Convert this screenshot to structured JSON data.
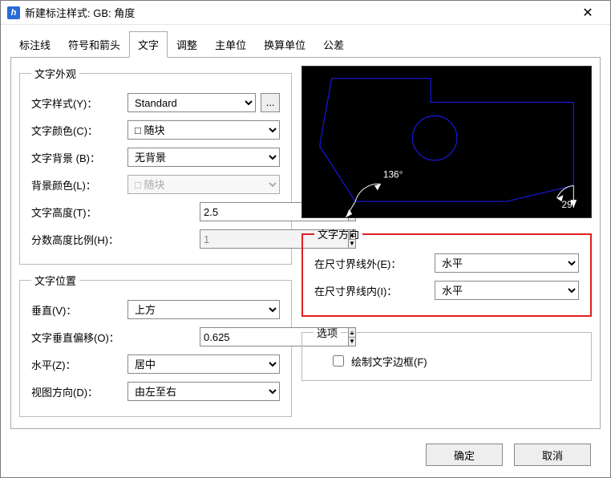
{
  "window": {
    "title": "新建标注样式: GB: 角度"
  },
  "tabs": {
    "items": [
      {
        "label": "标注线"
      },
      {
        "label": "符号和箭头"
      },
      {
        "label": "文字"
      },
      {
        "label": "调整"
      },
      {
        "label": "主单位"
      },
      {
        "label": "换算单位"
      },
      {
        "label": "公差"
      }
    ],
    "active_index": 2
  },
  "appearance": {
    "legend": "文字外观",
    "text_style_label": "文字样式(Y)：",
    "text_style_value": "Standard",
    "text_color_label": "文字颜色(C)：",
    "text_color_value": "随块",
    "text_bg_label": "文字背景 (B)：",
    "text_bg_value": "无背景",
    "bg_color_label": "背景颜色(L)：",
    "bg_color_value": "随块",
    "text_height_label": "文字高度(T)：",
    "text_height_value": "2.5",
    "frac_scale_label": "分数高度比例(H)：",
    "frac_scale_value": "1"
  },
  "placement": {
    "legend": "文字位置",
    "vertical_label": "垂直(V)：",
    "vertical_value": "上方",
    "voffset_label": "文字垂直偏移(O)：",
    "voffset_value": "0.625",
    "horizontal_label": "水平(Z)：",
    "horizontal_value": "居中",
    "view_dir_label": "视图方向(D)：",
    "view_dir_value": "由左至右"
  },
  "direction": {
    "legend": "文字方向",
    "outside_label": "在尺寸界线外(E)：",
    "outside_value": "水平",
    "inside_label": "在尺寸界线内(I)：",
    "inside_value": "水平"
  },
  "options": {
    "legend": "选项",
    "draw_frame_label": "绘制文字边框(F)"
  },
  "preview": {
    "angle1": "136°",
    "angle2": "29°"
  },
  "buttons": {
    "ok": "确定",
    "cancel": "取消"
  },
  "glyphs": {
    "ellipsis": "...",
    "up": "▲",
    "down": "▼"
  }
}
